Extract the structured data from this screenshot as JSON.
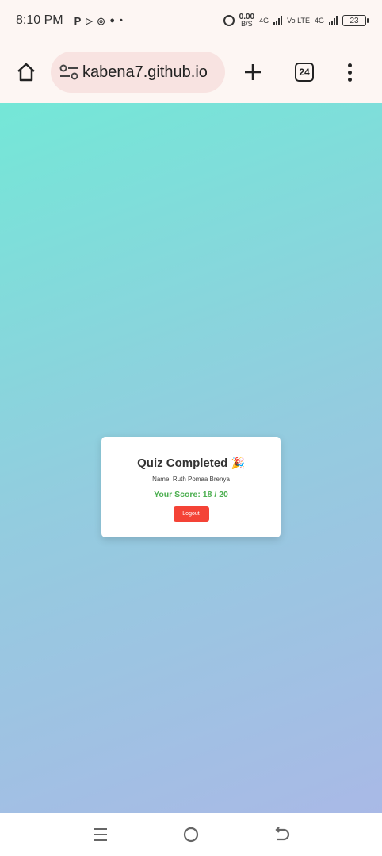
{
  "status_bar": {
    "time": "8:10 PM",
    "net_speed_value": "0.00",
    "net_speed_unit": "B/S",
    "sim1_type": "4G",
    "volte": "Vo LTE",
    "sim2_type": "4G",
    "battery": "23"
  },
  "browser": {
    "url": "kabena7.github.io",
    "tab_count": "24"
  },
  "quiz": {
    "title": "Quiz Completed",
    "title_emoji": "🎉",
    "name_line": "Name: Ruth Pomaa Brenya",
    "score_line": "Your Score: 18 / 20",
    "logout_label": "Logout"
  },
  "colors": {
    "gradient_start": "#74e7d7",
    "gradient_end": "#a9b9e6",
    "score_color": "#4caf50",
    "logout_button": "#f44336"
  },
  "icons": {
    "home": "home-icon",
    "site_settings": "tune-icon",
    "new_tab": "plus-icon",
    "menu": "more-vert-icon",
    "nav_recents": "recents-icon",
    "nav_home": "circle-home-icon",
    "nav_back": "back-icon"
  }
}
